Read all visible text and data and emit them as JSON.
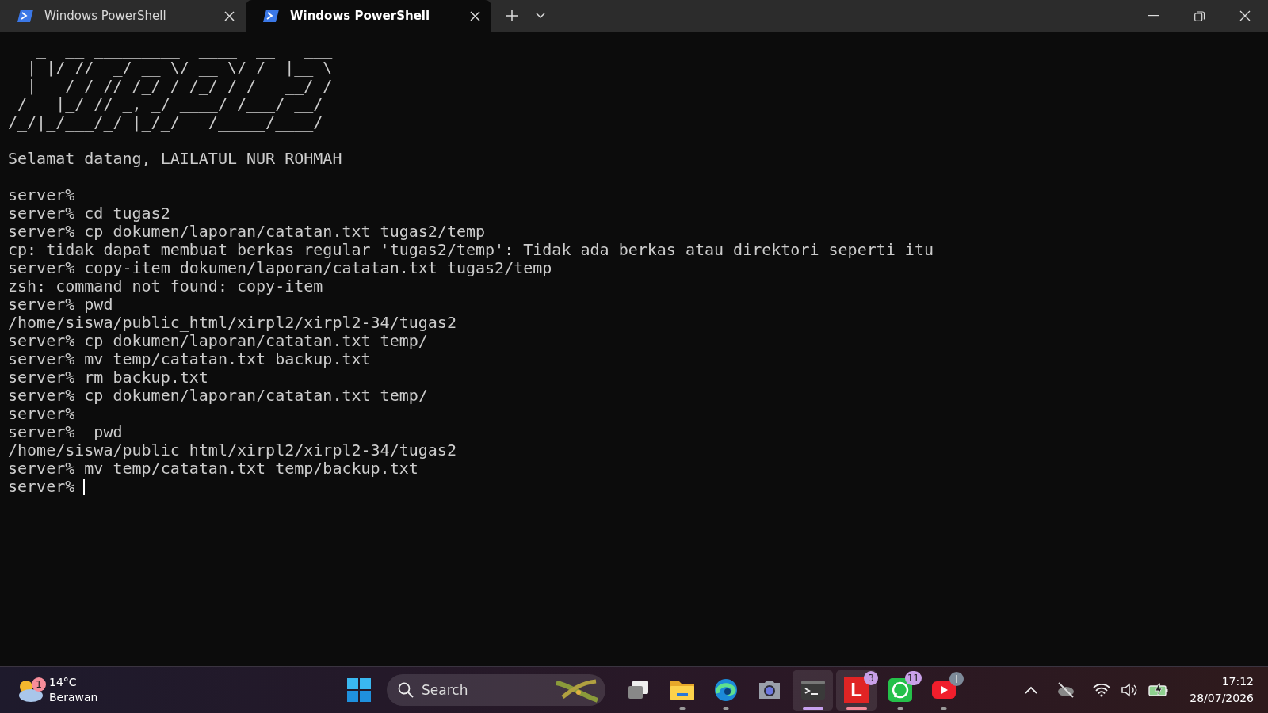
{
  "tabs": [
    {
      "title": "Windows PowerShell",
      "selected": false
    },
    {
      "title": "Windows PowerShell",
      "selected": true
    }
  ],
  "terminal": {
    "banner": [
      "   _  __ _________  ____  __   ___ ",
      "  | |/ //  _/ __ \\/ __ \\/ /  |__ \\",
      "  |   / / // /_/ / /_/ / /   __/ /",
      " /   |_/ // _, _/ ____/ /___/ __/ ",
      "/_/|_/___/_/ |_/_/   /_____/____/ "
    ],
    "welcome": "Selamat datang, LAILATUL NUR ROHMAH",
    "session": [
      "server%",
      "server% cd tugas2",
      "server% cp dokumen/laporan/catatan.txt tugas2/temp",
      "cp: tidak dapat membuat berkas regular 'tugas2/temp': Tidak ada berkas atau direktori seperti itu",
      "server% copy-item dokumen/laporan/catatan.txt tugas2/temp",
      "zsh: command not found: copy-item",
      "server% pwd",
      "/home/siswa/public_html/xirpl2/xirpl2-34/tugas2",
      "server% cp dokumen/laporan/catatan.txt temp/",
      "server% mv temp/catatan.txt backup.txt",
      "server% rm backup.txt",
      "server% cp dokumen/laporan/catatan.txt temp/",
      "server%",
      "server%  pwd",
      "/home/siswa/public_html/xirpl2/xirpl2-34/tugas2",
      "server% mv temp/catatan.txt temp/backup.txt"
    ],
    "prompt": "server%"
  },
  "taskbar": {
    "weather": {
      "badge": "1",
      "temperature": "14°C",
      "condition": "Berawan"
    },
    "search": {
      "placeholder": "Search"
    },
    "apps": [
      {
        "kind": "taskview",
        "running": false,
        "selected": false
      },
      {
        "kind": "folder",
        "running": true,
        "selected": false
      },
      {
        "kind": "browser",
        "running": true,
        "selected": false
      },
      {
        "kind": "camera",
        "running": false,
        "selected": false
      },
      {
        "kind": "terminal",
        "running": true,
        "selected": true
      },
      {
        "kind": "letter",
        "label": "L",
        "badge": "3",
        "running": true,
        "selected": true
      },
      {
        "kind": "chat",
        "badge": "11",
        "running": true,
        "selected": false
      },
      {
        "kind": "video",
        "alert": true,
        "running": true,
        "selected": false
      }
    ],
    "clock": {
      "time": "17:12",
      "date": "28/07/2026"
    }
  }
}
